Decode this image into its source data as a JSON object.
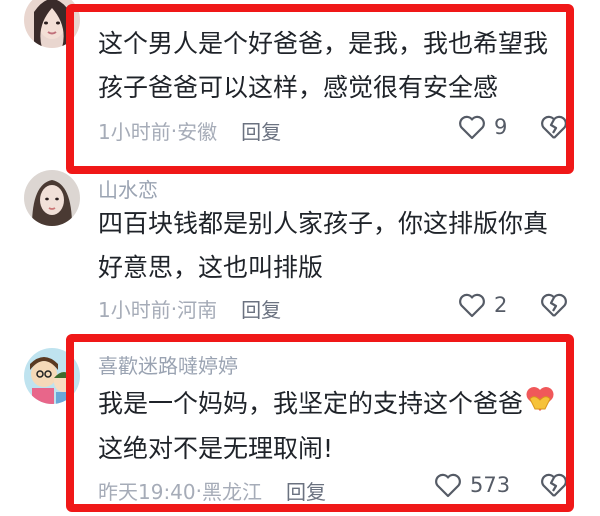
{
  "comments": [
    {
      "username": "",
      "lines": [
        "这个男人是个好爸爸，是我，我也希望我",
        "孩子爸爸可以这样，感觉很有安全感"
      ],
      "time": "1小时前",
      "location": "安徽",
      "reply_label": "回复",
      "likes": "9"
    },
    {
      "username": "山水恋",
      "lines": [
        "四百块钱都是别人家孩子，你这排版你真",
        "好意思，这也叫排版"
      ],
      "time": "1小时前",
      "location": "河南",
      "reply_label": "回复",
      "likes": "2"
    },
    {
      "username": "喜歡迷路噠婷婷",
      "lines": [
        "我是一个妈妈，我坚定的支持这个爸爸",
        "这绝对不是无理取闹!"
      ],
      "time": "昨天19:40",
      "location": "黑龙江",
      "reply_label": "回复",
      "likes": "573"
    }
  ],
  "separator": " · ",
  "colors": {
    "highlight": "#f01818",
    "text": "#1f2329",
    "meta": "#a6acb8"
  },
  "icons": [
    "heart-icon",
    "broken-heart-icon",
    "heart-hands-emoji"
  ]
}
